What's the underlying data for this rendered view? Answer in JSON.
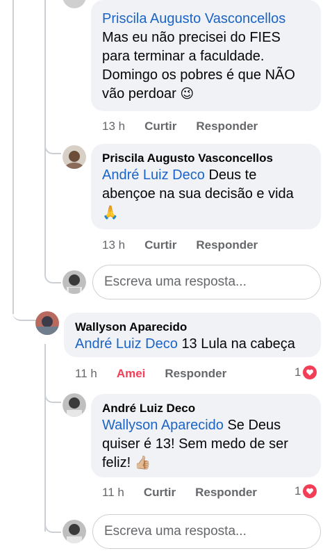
{
  "comments": [
    {
      "author": "Priscila Augusto Vasconcellos",
      "text": "Mas eu não precisei do FIES para terminar a faculdade. Domingo os pobres é que NÃO vão perdoar",
      "emoji": "😉",
      "time": "13 h",
      "like_label": "Curtir",
      "reply_label": "Responder"
    },
    {
      "author": "Priscila Augusto Vasconcellos",
      "mention": "André Luiz Deco",
      "text": "Deus te abençoe na sua decisão e vida",
      "emoji": "🙏",
      "time": "13 h",
      "like_label": "Curtir",
      "reply_label": "Responder"
    },
    {
      "author": "Wallyson Aparecido",
      "mention": "André Luiz Deco",
      "text": "13 Lula na cabeça",
      "time": "11 h",
      "like_label": "Amei",
      "reply_label": "Responder",
      "reaction_count": "1"
    },
    {
      "author": "André Luiz Deco",
      "mention": "Wallyson Aparecido",
      "text": "Se Deus quiser é 13! Sem medo de ser feliz!",
      "emoji": "👍🏼",
      "time": "11 h",
      "like_label": "Curtir",
      "reply_label": "Responder",
      "reaction_count": "1"
    }
  ],
  "reply_placeholder": "Escreva uma resposta...",
  "colors": {
    "mention": "#1a64c8",
    "love": "#f33e58",
    "bubble": "#f0f2f5",
    "meta": "#65676b"
  }
}
